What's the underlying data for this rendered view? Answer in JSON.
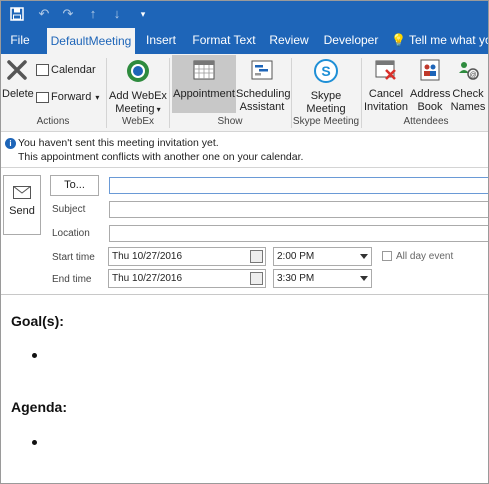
{
  "qat": {
    "save_icon": "save-icon",
    "undo_icon": "undo-icon",
    "redo_icon": "redo-icon",
    "up_icon": "up-arrow-icon",
    "down_icon": "down-arrow-icon",
    "customize_icon": "customize-qat-icon"
  },
  "tabs": [
    {
      "label": "File"
    },
    {
      "label": "DefaultMeeting"
    },
    {
      "label": "Insert"
    },
    {
      "label": "Format Text"
    },
    {
      "label": "Review"
    },
    {
      "label": "Developer"
    },
    {
      "label": "Tell me what you"
    }
  ],
  "ribbon": {
    "delete_label": "Delete",
    "calendar_label": "Calendar",
    "forward_label": "Forward",
    "actions_group": "Actions",
    "webex_line1": "Add WebEx",
    "webex_line2": "Meeting",
    "webex_group": "WebEx",
    "appointment_label": "Appointment",
    "scheduling_line1": "Scheduling",
    "scheduling_line2": "Assistant",
    "show_group": "Show",
    "skype_line1": "Skype",
    "skype_line2": "Meeting",
    "skype_group": "Skype Meeting",
    "cancel_line1": "Cancel",
    "cancel_line2": "Invitation",
    "address_line1": "Address",
    "address_line2": "Book",
    "check_line1": "Check",
    "check_line2": "Names",
    "attendees_group": "Attendees"
  },
  "info": {
    "line1": "You haven't sent this meeting invitation yet.",
    "line2": "This appointment conflicts with another one on your calendar."
  },
  "form": {
    "send_label": "Send",
    "to_button": "To...",
    "subject_label": "Subject",
    "location_label": "Location",
    "start_label": "Start time",
    "end_label": "End time",
    "start_date": "Thu 10/27/2016",
    "start_time": "2:00 PM",
    "end_date": "Thu 10/27/2016",
    "end_time": "3:30 PM",
    "all_day_label": "All day event"
  },
  "body": {
    "goals_heading": "Goal(s):",
    "agenda_heading": "Agenda:"
  },
  "colors": {
    "accent": "#1e65b8",
    "ribbon_bg": "#f3f3f3"
  }
}
